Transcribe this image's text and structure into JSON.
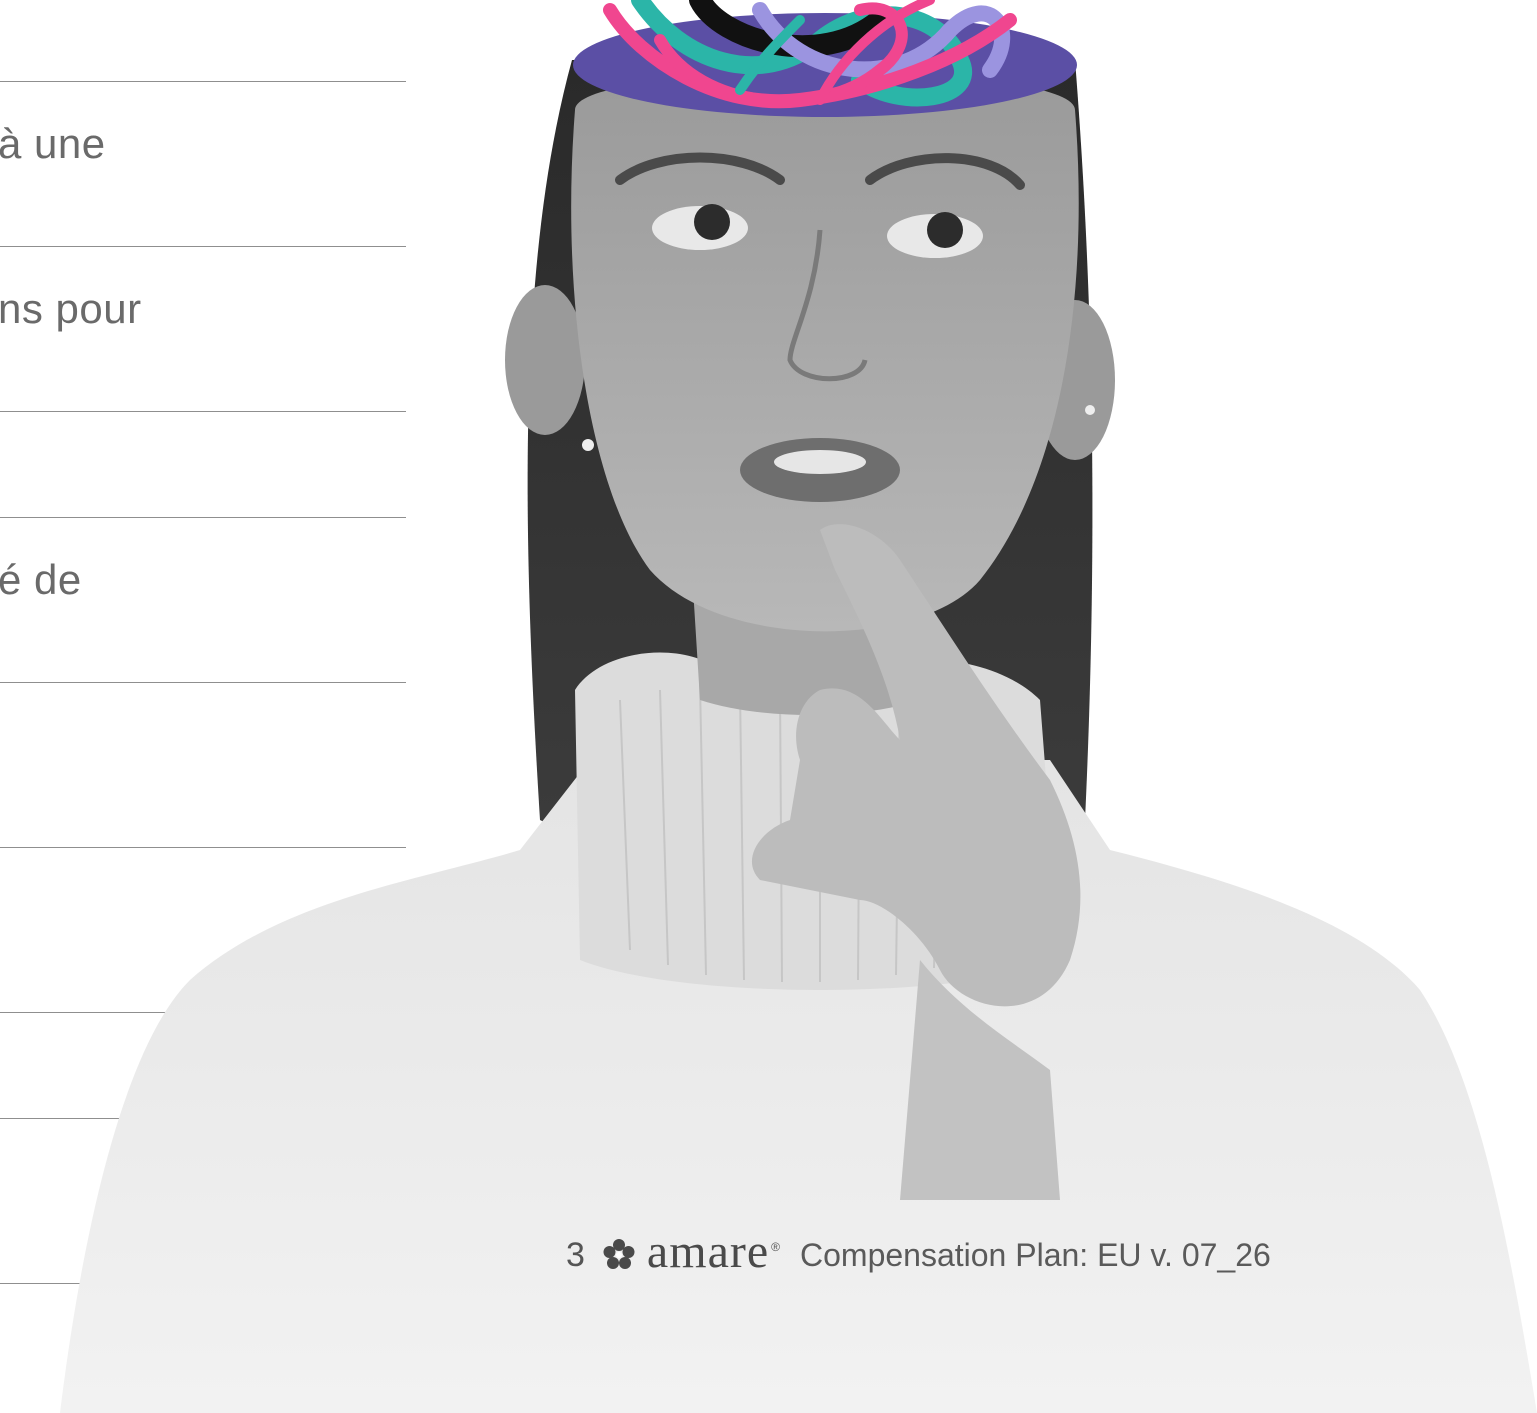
{
  "left_column": {
    "fragments": [
      "à une",
      "ns pour",
      "é de"
    ]
  },
  "footer": {
    "page_number": "3",
    "logo_icon": "flower-logo-icon",
    "logo_text": "amare",
    "logo_reg": "®",
    "document_title": "Compensation Plan: EU v. 07_26"
  },
  "colors": {
    "rule": "#8f8f8f",
    "text": "#6a6a6a",
    "scribble_pink": "#f0468f",
    "scribble_teal": "#2bb5a8",
    "scribble_lavender": "#9b94e0",
    "head_disc": "#5b4fa5"
  }
}
